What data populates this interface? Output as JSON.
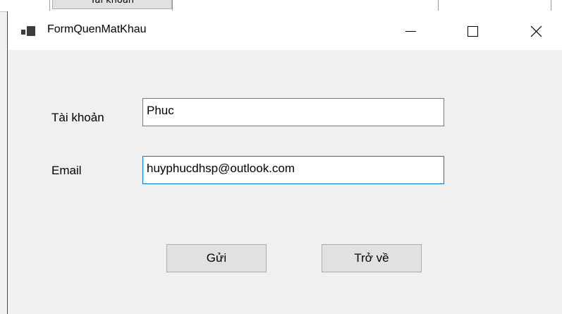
{
  "background_window": {
    "button_label": "Tài khoản"
  },
  "window": {
    "title": "FormQuenMatKhau",
    "icon": "winforms-app-icon",
    "controls": {
      "minimize_icon": "minimize-icon",
      "maximize_icon": "maximize-icon",
      "close_icon": "close-icon"
    }
  },
  "form": {
    "account_label": "Tài khoản",
    "account_value": "Phuc",
    "email_label": "Email",
    "email_value": "huyphucdhsp@outlook.com",
    "focused_field": "email",
    "send_button": "Gửi",
    "back_button": "Trở về"
  },
  "colors": {
    "focus_border": "#0078d7",
    "form_background": "#f0f0f0",
    "button_background": "#e1e1e1"
  }
}
